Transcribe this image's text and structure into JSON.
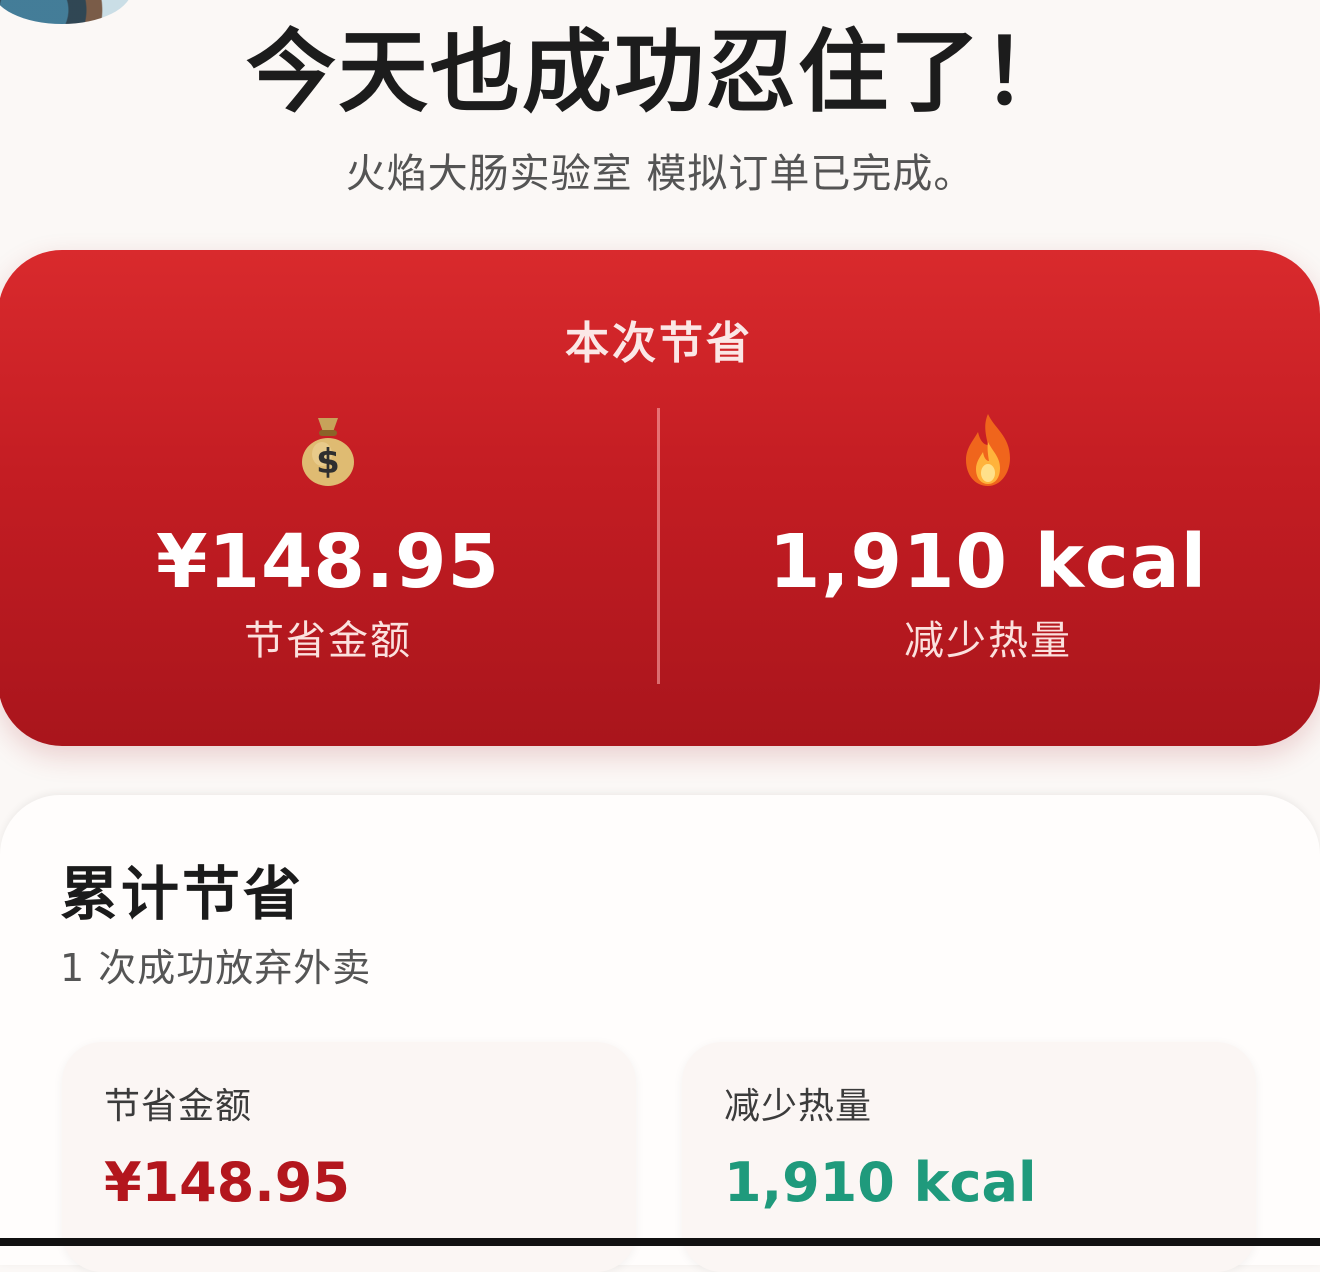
{
  "header": {
    "headline": "今天也成功忍住了！",
    "subtitle": "火焰大肠实验室 模拟订单已完成。"
  },
  "save_card": {
    "title": "本次节省",
    "money": {
      "icon": "money-bag-icon",
      "value": "¥148.95",
      "label": "节省金额"
    },
    "calories": {
      "icon": "fire-icon",
      "value": "1,910 kcal",
      "label": "减少热量"
    },
    "colors": {
      "card_top": "#d92a2d",
      "card_bottom": "#a9151c"
    }
  },
  "total_card": {
    "title": "累计节省",
    "subtitle": "1 次成功放弃外卖",
    "money": {
      "label": "节省金额",
      "value": "¥148.95",
      "color": "#b3161d"
    },
    "calories": {
      "label": "减少热量",
      "value": "1,910 kcal",
      "color": "#1f9a7c"
    }
  }
}
